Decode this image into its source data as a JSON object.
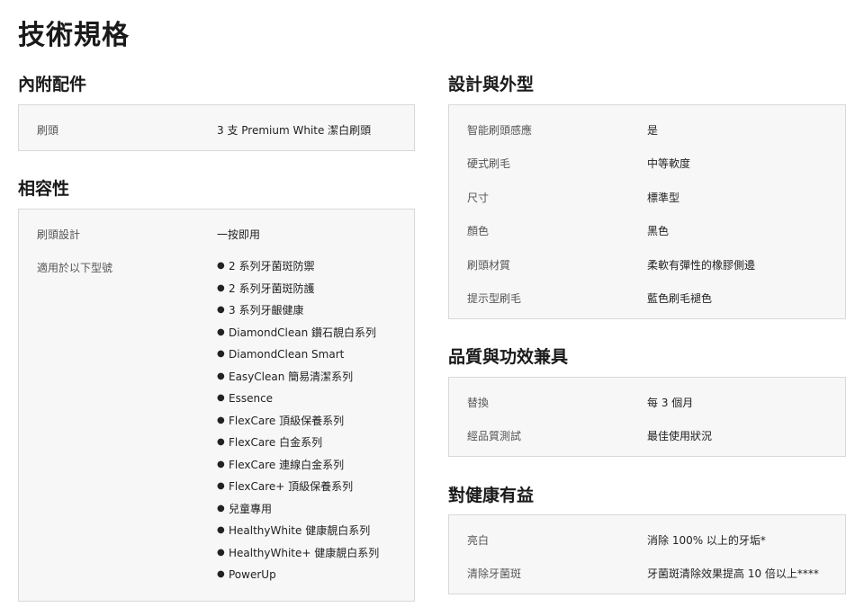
{
  "page_title": "技術規格",
  "sections": {
    "included": {
      "title": "內附配件",
      "rows": [
        {
          "label": "刷頭",
          "value": "3 支 Premium White 潔白刷頭"
        }
      ]
    },
    "compatibility": {
      "title": "相容性",
      "rows": [
        {
          "label": "刷頭設計",
          "value": "一按即用"
        },
        {
          "label": "適用於以下型號"
        }
      ],
      "models": [
        "2 系列牙菌斑防禦",
        "2 系列牙菌斑防護",
        "3 系列牙齦健康",
        "DiamondClean 鑽石靚白系列",
        "DiamondClean Smart",
        "EasyClean 簡易清潔系列",
        "Essence",
        "FlexCare 頂級保養系列",
        "FlexCare 白金系列",
        "FlexCare 連線白金系列",
        "FlexCare+ 頂級保養系列",
        "兒童專用",
        "HealthyWhite 健康靚白系列",
        "HealthyWhite+ 健康靚白系列",
        "PowerUp"
      ]
    },
    "design": {
      "title": "設計與外型",
      "rows": [
        {
          "label": "智能刷頭感應",
          "value": "是"
        },
        {
          "label": "硬式刷毛",
          "value": "中等軟度"
        },
        {
          "label": "尺寸",
          "value": "標準型"
        },
        {
          "label": "顏色",
          "value": "黑色"
        },
        {
          "label": "刷頭材質",
          "value": "柔軟有彈性的橡膠側邊"
        },
        {
          "label": "提示型刷毛",
          "value": "藍色刷毛褪色"
        }
      ]
    },
    "quality": {
      "title": "品質與功效兼具",
      "rows": [
        {
          "label": "替換",
          "value": "每 3 個月"
        },
        {
          "label": "經品質測試",
          "value": "最佳使用狀況"
        }
      ]
    },
    "health": {
      "title": "對健康有益",
      "rows": [
        {
          "label": "亮白",
          "value": "消除 100% 以上的牙垢*"
        },
        {
          "label": "清除牙菌斑",
          "value": "牙菌斑清除效果提高 10 倍以上****"
        }
      ]
    }
  }
}
